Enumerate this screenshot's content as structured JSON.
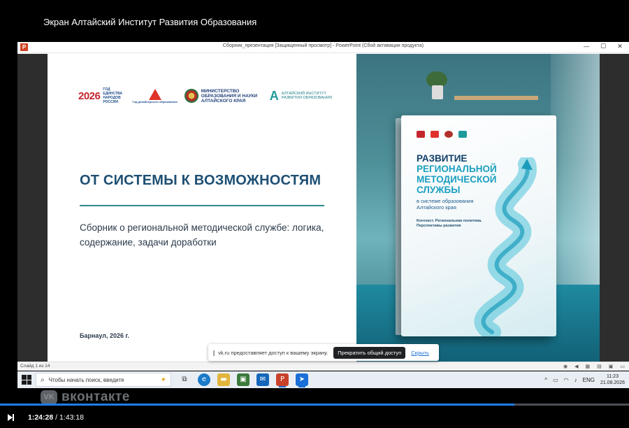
{
  "stream": {
    "title": "Экран Алтайский Институт Развития Образования"
  },
  "ppt": {
    "app_icon": "P",
    "window_title": "Сборник_презентация [Защищенный просмотр] - PowerPoint (Сбой активации продукта)",
    "controls": {
      "minimize": "—",
      "maximize": "☐",
      "close": "✕"
    },
    "status": {
      "slide_counter": "Слайд 1 из 14"
    }
  },
  "slide": {
    "logos": {
      "year_logo": "2026",
      "year_logo_sub": "ГОД ЕДИНСТВА НАРОДОВ РОССИИ",
      "pedagogy_logo_caption": "Год дизайнерского образования",
      "ministry": "МИНИСТЕРСТВО ОБРАЗОВАНИЯ И НАУКИ АЛТАЙСКОГО КРАЯ",
      "institute_mark": "A",
      "institute": "АЛТАЙСКИЙ ИНСТИТУТ РАЗВИТИЯ ОБРАЗОВАНИЯ"
    },
    "title": "ОТ СИСТЕМЫ К ВОЗМОЖНОСТЯМ",
    "subtitle": "Сборник о региональной методической службе: логика, содержание, задачи доработки",
    "city_year": "Барнаул, 2026 г.",
    "book": {
      "title_l1": "РАЗВИТИЕ",
      "title_l2": "РЕГИОНАЛЬНОЙ",
      "title_l3": "МЕТОДИЧЕСКОЙ",
      "title_l4": "СЛУЖБЫ",
      "subtitle": "в системе образования Алтайского края",
      "context": "Контекст. Региональная политика. Перспективы развития"
    }
  },
  "share_bar": {
    "grip": "|||",
    "message": "vk.ru предоставляет доступ к вашему экрану.",
    "stop_label": "Прекратить общий доступ",
    "hide_label": "Скрыть"
  },
  "taskbar": {
    "search_placeholder": "Чтобы начать поиск, введите",
    "tray": {
      "chevron": "^",
      "lang": "ENG",
      "time": "11:23",
      "date": "21.08.2026"
    }
  },
  "player": {
    "watermark": "вконтакте",
    "watermark_logo": "VK",
    "current_time": "1:24:28",
    "separator": " / ",
    "duration": "1:43:18",
    "progress": 0.818
  },
  "colors": {
    "title": "#1e4f73",
    "accent_teal": "#2b8a8a",
    "progress": "#1e7de9",
    "ppt_red": "#d04423"
  }
}
